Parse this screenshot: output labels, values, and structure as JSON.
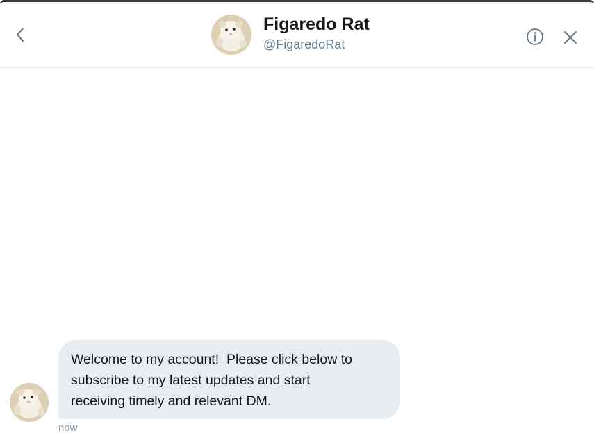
{
  "header": {
    "display_name": "Figaredo Rat",
    "handle": "@FigaredoRat",
    "back_icon": "chevron-left-icon",
    "info_icon": "info-icon",
    "close_icon": "close-icon"
  },
  "message": {
    "lines": [
      "Welcome to my account!  Please click below to",
      "subscribe to my latest updates and start",
      "receiving timely and relevant DM."
    ],
    "timestamp": "now"
  },
  "colors": {
    "bubble": "#e6ecf0",
    "text": "#14171a",
    "secondary": "#657786",
    "divider": "#e6ecf0"
  }
}
